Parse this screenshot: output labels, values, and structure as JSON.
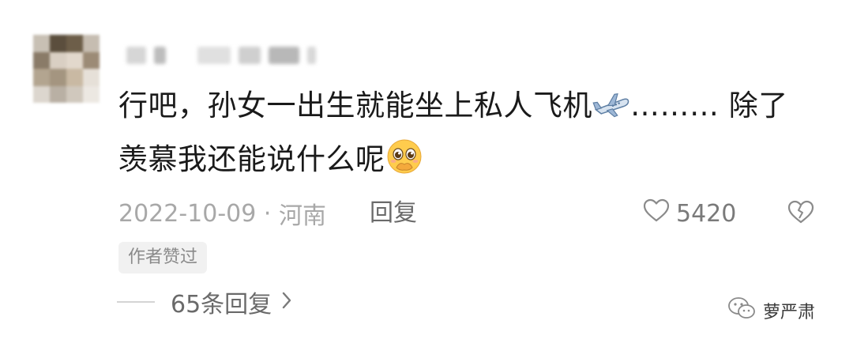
{
  "comment": {
    "text_line1": "行吧，孙女一出生就能坐上私人飞机",
    "text_line1_suffix": "……… 除了",
    "text_line2": "羡慕我还能说什么呢",
    "emoji_plane": "airplane-emoji",
    "emoji_face": "pleading-face-emoji"
  },
  "meta": {
    "date": "2022-10-09",
    "separator": " · ",
    "location": "河南",
    "reply_label": "回复",
    "likes": "5420"
  },
  "badge": {
    "label": "作者赞过"
  },
  "replies": {
    "label": "65条回复"
  },
  "watermark": {
    "name": "萝严肃"
  },
  "colors": {
    "text": "#1a1a1a",
    "meta": "#a8a8a8",
    "secondary": "#6a6a6a",
    "badge_bg": "#f1f1f1"
  }
}
